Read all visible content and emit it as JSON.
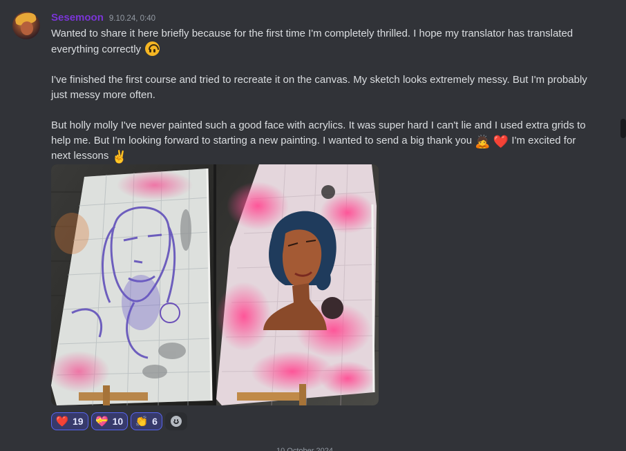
{
  "message": {
    "username": "Sesemoon",
    "timestamp": "9.10.24, 0:40",
    "paragraph1_text": "Wanted to share it here briefly because for the first time I'm completely thrilled.  I hope my translator has translated everything correctly",
    "paragraph2_text": "I've finished the first course and tried to recreate it on the canvas. My sketch looks extremely messy. But I'm probably just messy more often.",
    "paragraph3_text_a": "But holly molly I've never painted such a good face with acrylics. It was super hard I can't lie and I used extra grids to help me. But I'm looking forward to starting a new painting. I wanted to send a big thank you",
    "paragraph3_text_b": "I'm excited for next lessons",
    "emojis": {
      "upside_down": "upside-down-face",
      "person_bowing": "🙇",
      "heart": "❤️",
      "victory": "✌️"
    }
  },
  "attachments": [
    {
      "name": "sketch-painting-photo"
    },
    {
      "name": "finished-painting-photo"
    }
  ],
  "reactions": [
    {
      "emoji": "❤️",
      "count": "19"
    },
    {
      "emoji": "💝",
      "count": "10"
    },
    {
      "emoji": "👏",
      "count": "6"
    }
  ],
  "divider_text": "10 October 2024",
  "colors": {
    "background": "#313338",
    "username": "#7a35d6",
    "reaction_bg": "#373a6b",
    "reaction_border": "#5865f2"
  }
}
